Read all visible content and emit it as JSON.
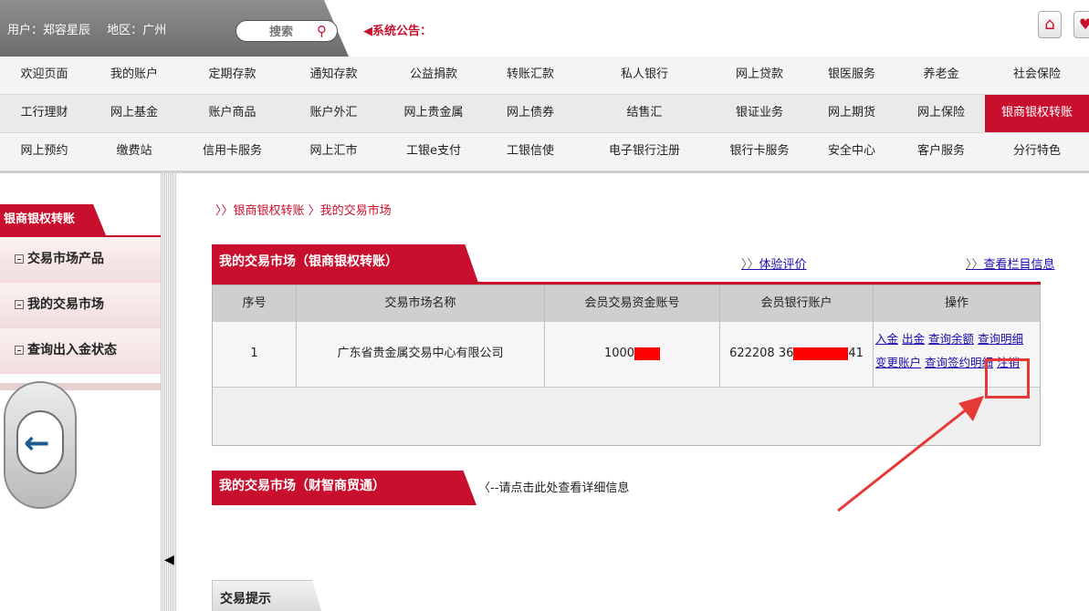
{
  "user": {
    "label": "用户：",
    "name": "郑容星辰",
    "region_label": "地区：",
    "region": "广州"
  },
  "search": {
    "placeholder": "搜索"
  },
  "notice": {
    "label": "系统公告："
  },
  "nav": {
    "rows": [
      [
        "欢迎页面",
        "我的账户",
        "定期存款",
        "通知存款",
        "公益捐款",
        "转账汇款",
        "私人银行",
        "网上贷款",
        "银医服务",
        "养老金",
        "社会保险"
      ],
      [
        "工行理财",
        "网上基金",
        "账户商品",
        "账户外汇",
        "网上贵金属",
        "网上债券",
        "结售汇",
        "银证业务",
        "网上期货",
        "网上保险",
        "银商银权转账"
      ],
      [
        "网上预约",
        "缴费站",
        "信用卡服务",
        "网上汇市",
        "工银e支付",
        "工银信使",
        "电子银行注册",
        "银行卡服务",
        "安全中心",
        "客户服务",
        "分行特色"
      ]
    ],
    "active": "银商银权转账"
  },
  "sidebar": {
    "title": "银商银权转账",
    "items": [
      {
        "label": "交易市场产品"
      },
      {
        "label": "我的交易市场"
      },
      {
        "label": "查询出入金状态"
      }
    ]
  },
  "breadcrumb": {
    "text": "〉〉银商银权转账 〉我的交易市场"
  },
  "panel1": {
    "title": "我的交易市场（银商银权转账）",
    "link_eval_prefix": "〉〉",
    "link_eval": "体验评价",
    "link_info_prefix": "〉〉",
    "link_info": "查看栏目信息",
    "columns": [
      "序号",
      "交易市场名称",
      "会员交易资金账号",
      "会员银行账户",
      "操作"
    ],
    "rows": [
      {
        "index": "1",
        "market": "广东省贵金属交易中心有限公司",
        "fund_account_prefix": "1000",
        "bank_account_prefix": "622208 36",
        "bank_account_suffix": "41",
        "ops_line1": [
          "入金",
          "出金",
          "查询余额",
          "查询明细"
        ],
        "ops_line2": [
          "变更账户",
          "查询签约明细",
          "注销"
        ]
      }
    ]
  },
  "panel2": {
    "title": "我的交易市场（财智商贸通）",
    "hint": "〈--请点击此处查看详细信息"
  },
  "tips": {
    "title": "交易提示"
  },
  "colors": {
    "brand": "#c8102e",
    "link": "#1a0dab",
    "highlight": "#e53935"
  }
}
